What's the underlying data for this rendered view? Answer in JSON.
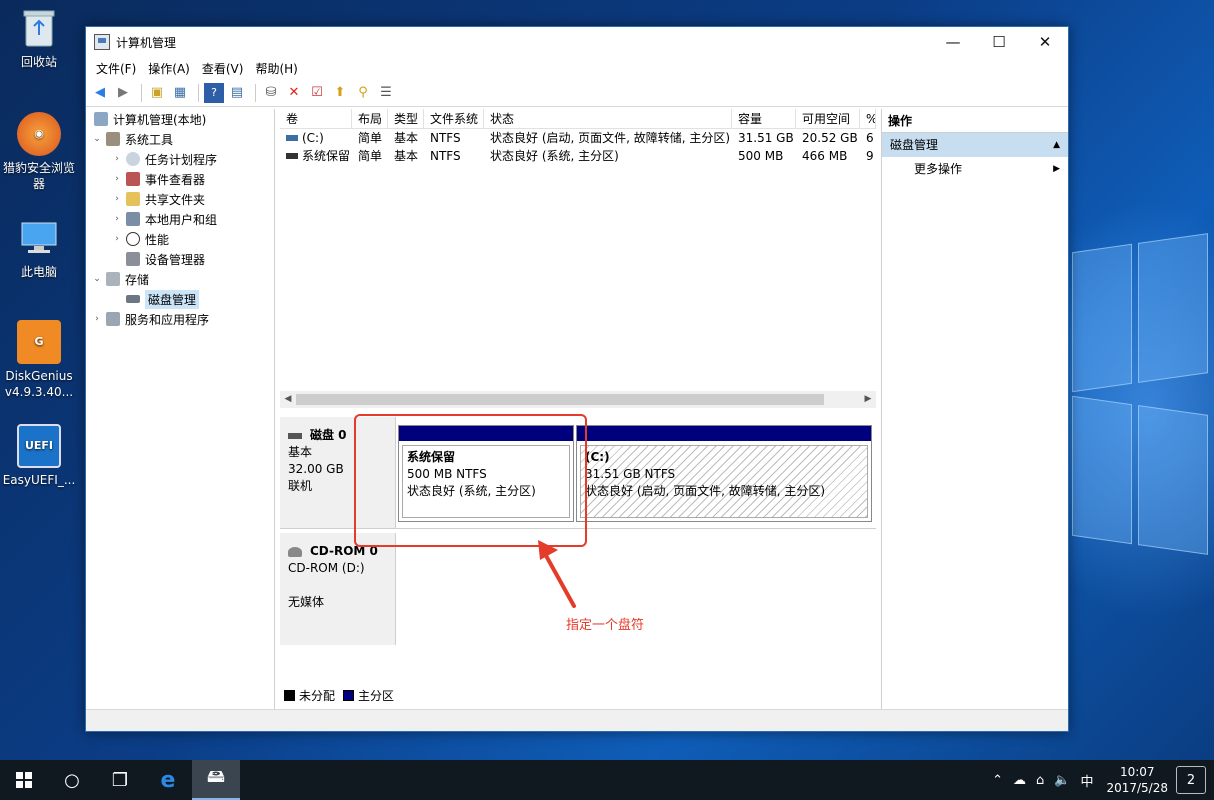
{
  "desktop": {
    "icons": [
      {
        "label": "回收站",
        "icon": "recycle-bin-icon"
      },
      {
        "label": "猎豹安全浏览器",
        "icon": "cheetah-browser-icon"
      },
      {
        "label": "此电脑",
        "icon": "this-pc-icon"
      },
      {
        "label": "DiskGenius v4.9.3.40...",
        "icon": "diskgenius-icon"
      },
      {
        "label": "EasyUEFI_...",
        "icon": "easyuefi-icon"
      }
    ]
  },
  "window": {
    "title": "计算机管理",
    "controls": {
      "minimize": "—",
      "maximize": "☐",
      "close": "✕"
    }
  },
  "menu": [
    "文件(F)",
    "操作(A)",
    "查看(V)",
    "帮助(H)"
  ],
  "tree": {
    "root": "计算机管理(本地)",
    "items": [
      {
        "label": "系统工具",
        "level": 1,
        "expanded": true
      },
      {
        "label": "任务计划程序",
        "level": 2
      },
      {
        "label": "事件查看器",
        "level": 2
      },
      {
        "label": "共享文件夹",
        "level": 2
      },
      {
        "label": "本地用户和组",
        "level": 2
      },
      {
        "label": "性能",
        "level": 2
      },
      {
        "label": "设备管理器",
        "level": 2
      },
      {
        "label": "存储",
        "level": 1,
        "expanded": true
      },
      {
        "label": "磁盘管理",
        "level": 2,
        "selected": true
      },
      {
        "label": "服务和应用程序",
        "level": 1
      }
    ]
  },
  "volumes": {
    "columns": [
      "卷",
      "布局",
      "类型",
      "文件系统",
      "状态",
      "容量",
      "可用空间",
      "%"
    ],
    "rows": [
      [
        "(C:)",
        "简单",
        "基本",
        "NTFS",
        "状态良好 (启动, 页面文件, 故障转储, 主分区)",
        "31.51 GB",
        "20.52 GB",
        "6"
      ],
      [
        "系统保留",
        "简单",
        "基本",
        "NTFS",
        "状态良好 (系统, 主分区)",
        "500 MB",
        "466 MB",
        "9"
      ]
    ]
  },
  "disks": [
    {
      "name": "磁盘 0",
      "type": "基本",
      "size": "32.00 GB",
      "state": "联机",
      "partitions": [
        {
          "name": "系统保留",
          "size_fs": "500 MB NTFS",
          "status": "状态良好 (系统, 主分区)"
        },
        {
          "name": "(C:)",
          "size_fs": "31.51 GB NTFS",
          "status": "状态良好 (启动, 页面文件, 故障转储, 主分区)"
        }
      ]
    },
    {
      "name": "CD-ROM 0",
      "type": "CD-ROM (D:)",
      "media": "无媒体"
    }
  ],
  "legend": [
    {
      "label": "未分配",
      "color": "#000000"
    },
    {
      "label": "主分区",
      "color": "#00007f"
    }
  ],
  "actions": {
    "header": "操作",
    "section": "磁盘管理",
    "more": "更多操作"
  },
  "annotation": {
    "text": "指定一个盘符",
    "color": "#e53b2b"
  },
  "taskbar": {
    "time": "10:07",
    "date": "2017/5/28",
    "ime": "中",
    "notifications": "2"
  }
}
